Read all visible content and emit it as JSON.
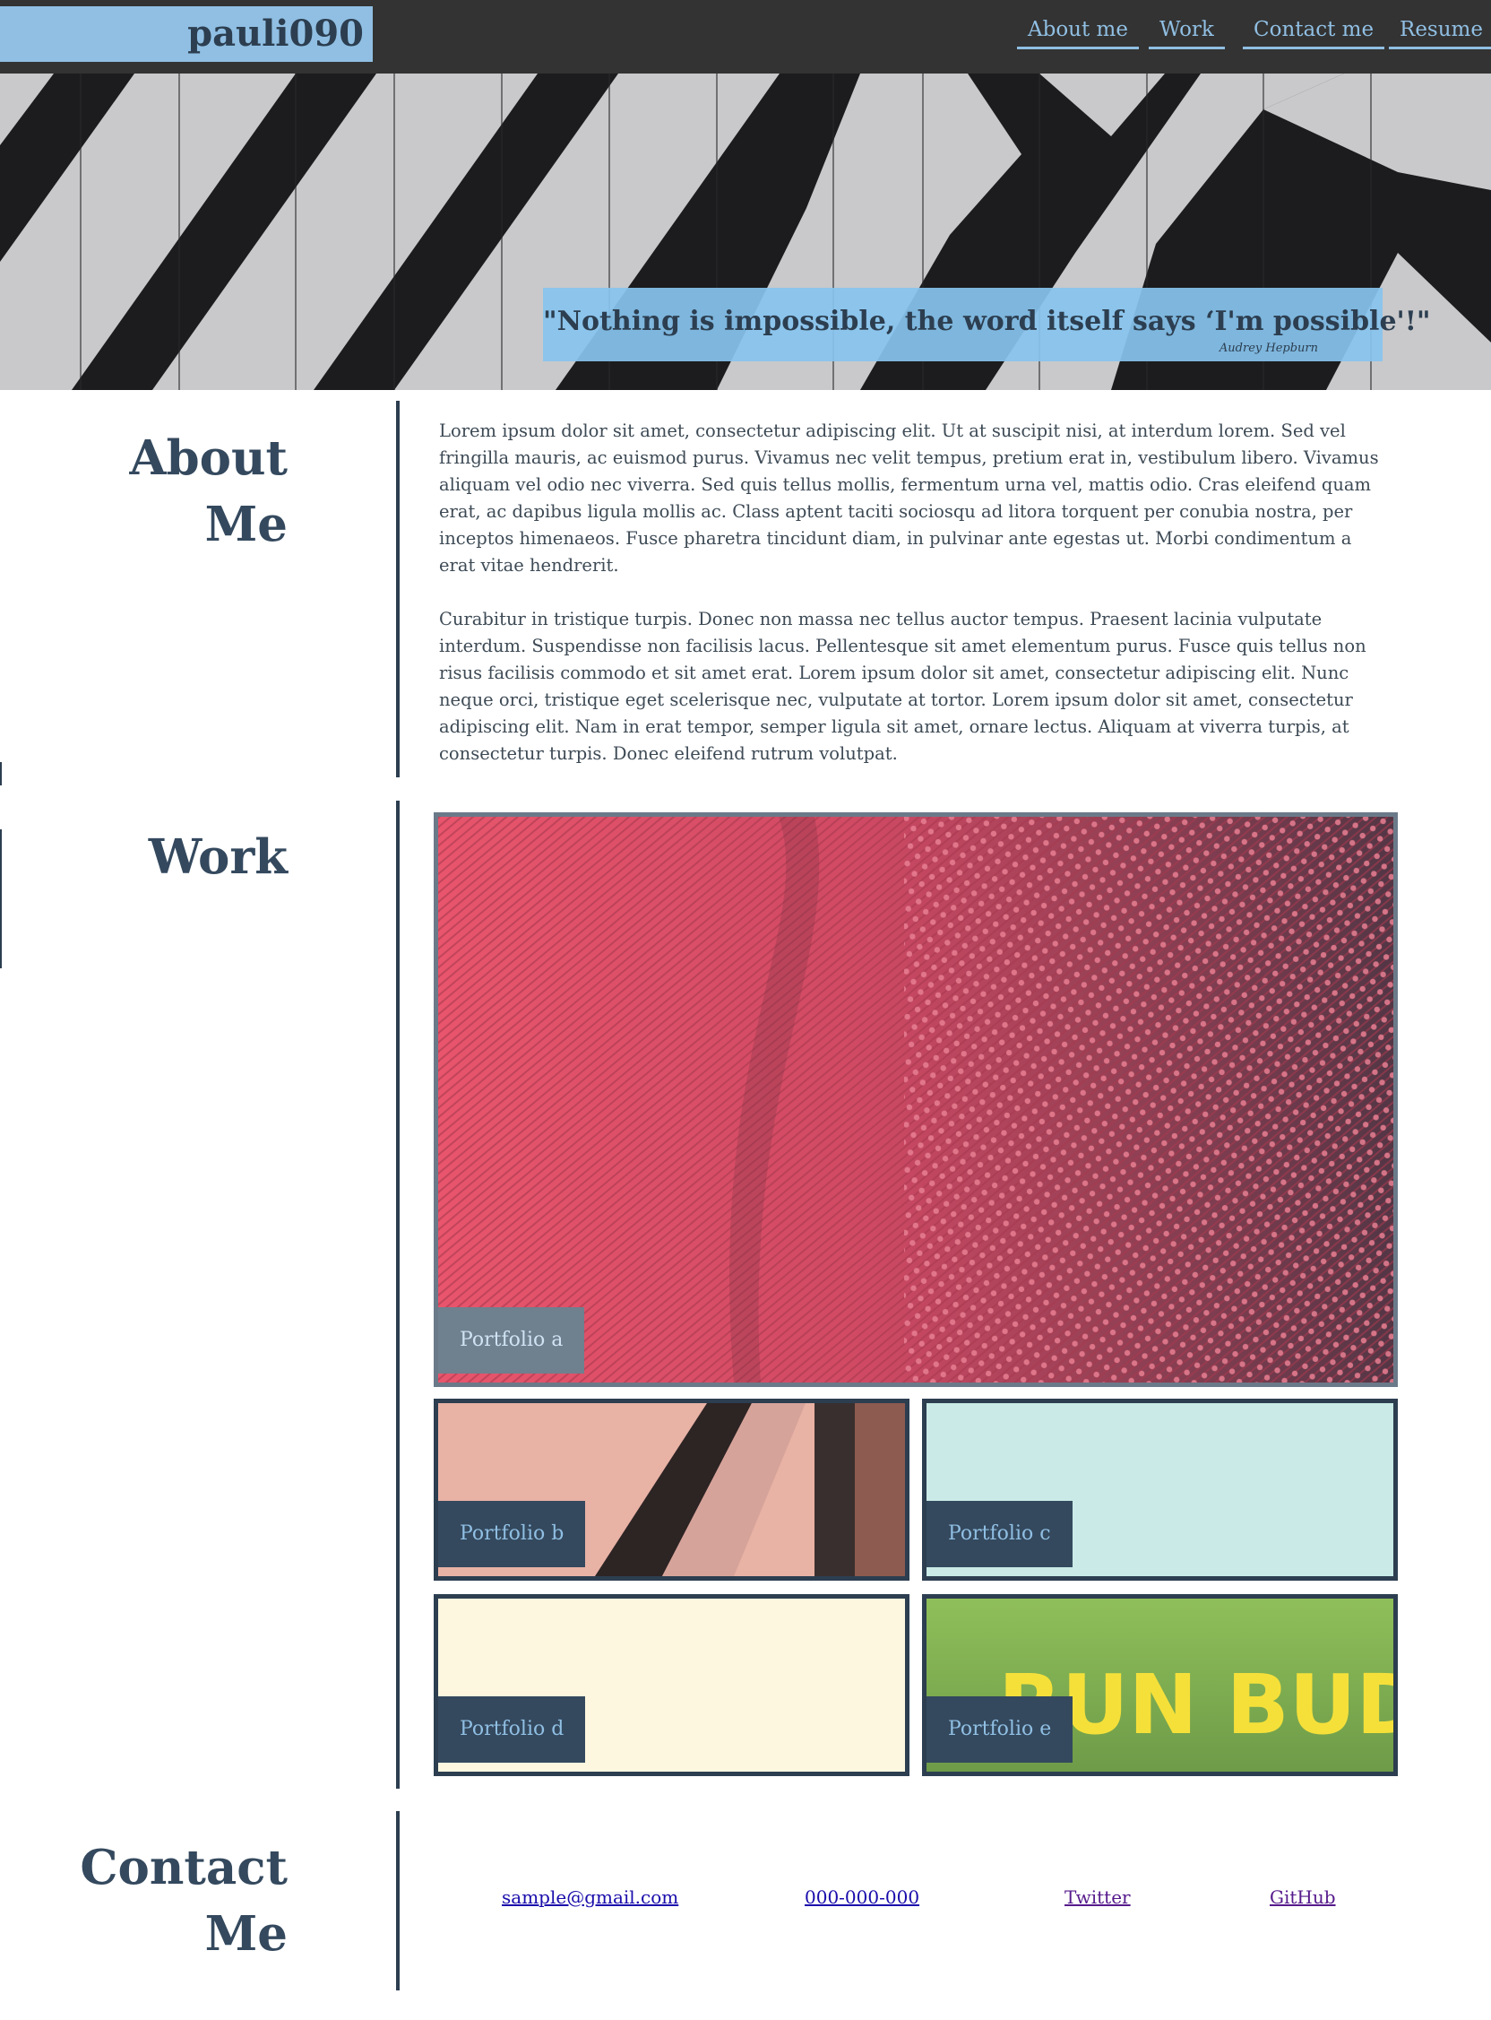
{
  "header": {
    "logo": "pauli090",
    "nav": [
      "About me",
      "Work",
      "Contact me",
      "Resume"
    ]
  },
  "hero": {
    "quote": "\"Nothing is impossible, the word itself says ‘I'm possible'!\"",
    "author": "Audrey Hepburn"
  },
  "about": {
    "title_line1": "About",
    "title_line2": "Me",
    "paragraphs": [
      "Lorem ipsum dolor sit amet, consectetur adipiscing elit. Ut at suscipit nisi, at interdum lorem. Sed vel fringilla mauris, ac euismod purus. Vivamus nec velit tempus, pretium erat in, vestibulum libero. Vivamus aliquam vel odio nec viverra. Sed quis tellus mollis, fermentum urna vel, mattis odio. Cras eleifend quam erat, ac dapibus ligula mollis ac. Class aptent taciti sociosqu ad litora torquent per conubia nostra, per inceptos himenaeos. Fusce pharetra tincidunt diam, in pulvinar ante egestas ut. Morbi condimentum a erat vitae hendrerit.",
      "Curabitur in tristique turpis. Donec non massa nec tellus auctor tempus. Praesent lacinia vulputate interdum. Suspendisse non facilisis lacus. Pellentesque sit amet elementum purus. Fusce quis tellus non risus facilisis commodo et sit amet erat. Lorem ipsum dolor sit amet, consectetur adipiscing elit. Nunc neque orci, tristique eget scelerisque nec, vulputate at tortor. Lorem ipsum dolor sit amet, consectetur adipiscing elit. Nam in erat tempor, semper ligula sit amet, ornare lectus. Aliquam at viverra turpis, at consectetur turpis. Donec eleifend rutrum volutpat."
    ]
  },
  "work": {
    "title": "Work",
    "tiles": [
      {
        "label": "Portfolio a"
      },
      {
        "label": "Portfolio b"
      },
      {
        "label": "Portfolio c"
      },
      {
        "label": "Portfolio d"
      },
      {
        "label": "Portfolio e",
        "image_text": "RUN BUDI"
      }
    ]
  },
  "contact": {
    "title_line1": "Contact",
    "title_line2": "Me",
    "links": [
      "sample@gmail.com",
      "000-000-000",
      "Twitter",
      "GitHub"
    ]
  },
  "colors": {
    "header_bg": "#333333",
    "accent": "#90bfe3",
    "heading": "#34495e",
    "border": "#2c3e50"
  }
}
